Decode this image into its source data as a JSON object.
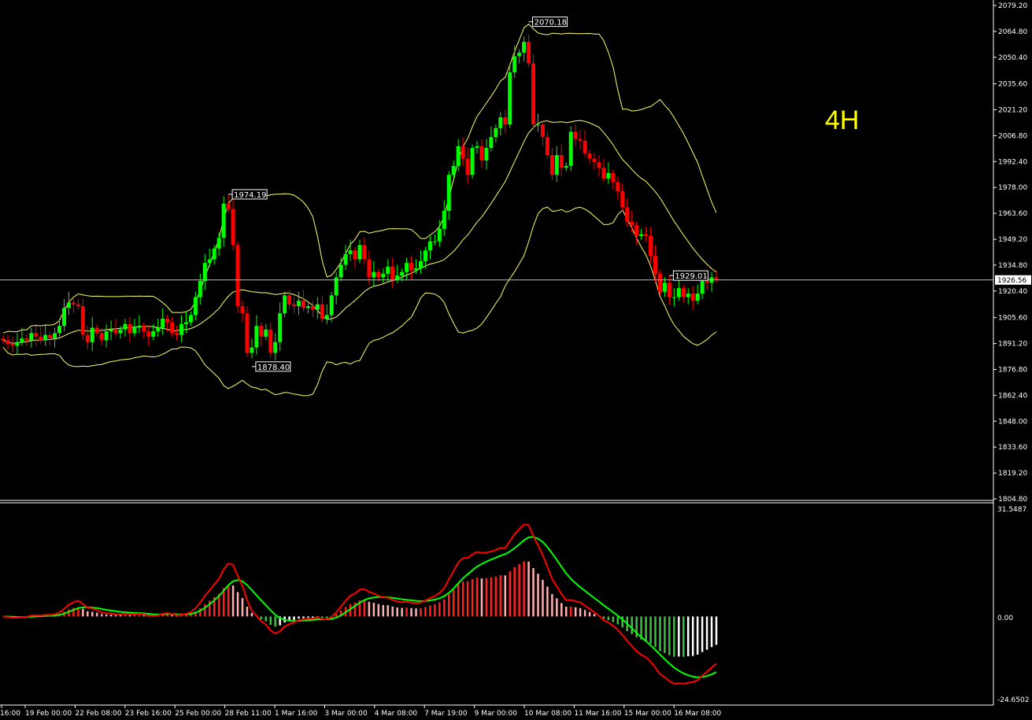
{
  "chart_data": [
    {
      "type": "candlestick",
      "timeframe_label": "4H",
      "current_price": "1926.56",
      "y_ticks": [
        "2079.20",
        "2064.80",
        "2050.40",
        "2035.60",
        "2021.20",
        "2006.80",
        "1992.40",
        "1978.00",
        "1963.60",
        "1949.20",
        "1934.80",
        "1920.40",
        "1905.60",
        "1891.20",
        "1876.80",
        "1862.40",
        "1848.00",
        "1833.60",
        "1819.20",
        "1804.80"
      ],
      "ylim": [
        1804.8,
        2079.2
      ],
      "x_ticks": [
        "16:00",
        "19 Feb 00:00",
        "22 Feb 08:00",
        "23 Feb 16:00",
        "25 Feb 00:00",
        "28 Feb 11:00",
        "1 Mar 16:00",
        "3 Mar 00:00",
        "4 Mar 08:00",
        "7 Mar 19:00",
        "9 Mar 00:00",
        "10 Mar 08:00",
        "11 Mar 16:00",
        "15 Mar 00:00",
        "16 Mar 08:00"
      ],
      "annotations": [
        {
          "text": "2070.18",
          "value": 2070.18
        },
        {
          "text": "1974.19",
          "value": 1974.19
        },
        {
          "text": "1929.01",
          "value": 1929.01
        },
        {
          "text": "1878.40",
          "value": 1878.4
        }
      ],
      "close_series": [
        1893,
        1891,
        1890,
        1892,
        1894,
        1893,
        1897,
        1895,
        1893,
        1896,
        1894,
        1897,
        1901,
        1911,
        1914,
        1913,
        1912,
        1896,
        1892,
        1900,
        1897,
        1893,
        1898,
        1899,
        1897,
        1899,
        1902,
        1897,
        1900,
        1901,
        1898,
        1895,
        1898,
        1900,
        1905,
        1903,
        1897,
        1896,
        1902,
        1903,
        1907,
        1917,
        1926,
        1936,
        1938,
        1944,
        1950,
        1969,
        1966,
        1946,
        1912,
        1908,
        1886,
        1889,
        1901,
        1895,
        1899,
        1886,
        1892,
        1908,
        1918,
        1913,
        1912,
        1915,
        1911,
        1912,
        1910,
        1913,
        1905,
        1907,
        1918,
        1928,
        1935,
        1941,
        1943,
        1938,
        1946,
        1938,
        1928,
        1931,
        1928,
        1930,
        1934,
        1927,
        1929,
        1931,
        1936,
        1932,
        1933,
        1937,
        1943,
        1948,
        1948,
        1955,
        1965,
        1985,
        1990,
        2001,
        1994,
        1985,
        2000,
        2001,
        1993,
        2000,
        2006,
        2011,
        2017,
        2013,
        2042,
        2051,
        2053,
        2059,
        2047,
        2013,
        2013,
        2006,
        1996,
        1985,
        1996,
        1989,
        1990,
        2009,
        2005,
        2004,
        1997,
        1994,
        1992,
        1989,
        1983,
        1986,
        1981,
        1976,
        1967,
        1959,
        1957,
        1951,
        1952,
        1951,
        1940,
        1930,
        1920,
        1925,
        1917,
        1917,
        1922,
        1917,
        1919,
        1915,
        1919,
        1926,
        1925,
        1928,
        1927
      ]
    },
    {
      "type": "macd",
      "ylim": [
        -24.6502,
        31.5487
      ],
      "y_ticks": [
        "31.5487",
        "0.00",
        "-24.6502"
      ]
    }
  ]
}
